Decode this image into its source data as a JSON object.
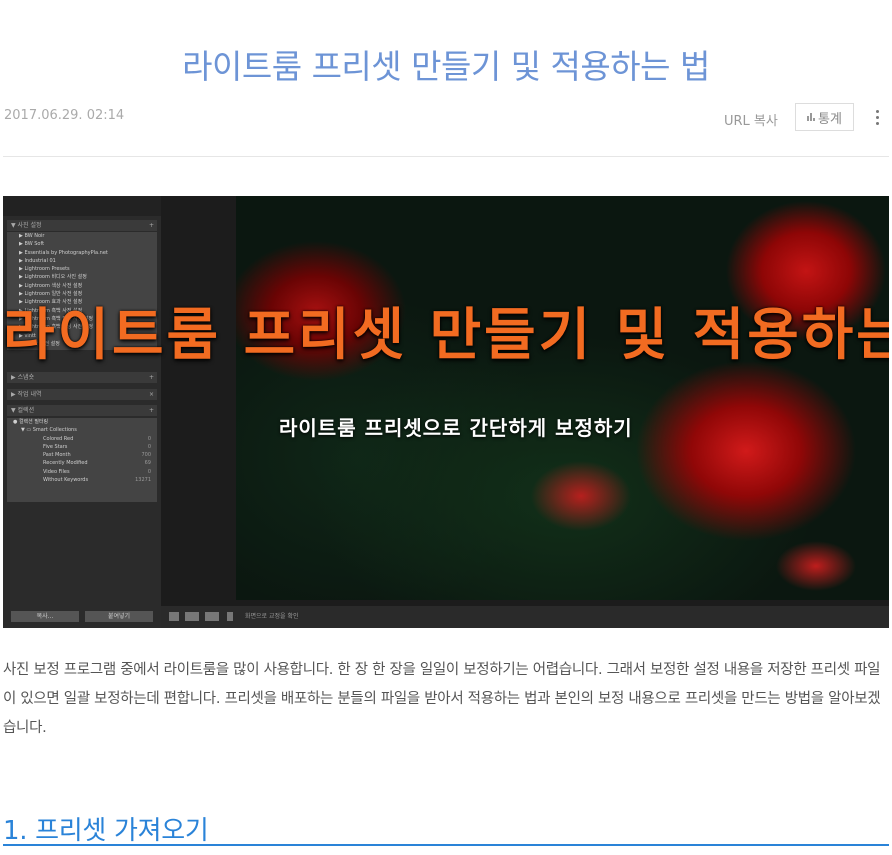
{
  "post": {
    "title": "라이트룸 프리셋 만들기 및 적용하는 법",
    "date": "2017.06.29. 02:14",
    "url_copy": "URL 복사",
    "stats": "통계"
  },
  "hero": {
    "overlay_title": "라이트룸 프리셋 만들기 및 적용하는 법",
    "overlay_subtitle": "라이트룸 프리셋으로 간단하게 보정하기",
    "lightroom": {
      "presets_header": "사진 설정",
      "presets": [
        "BW Noir",
        "BW Soft",
        "Essentials by PhotographyPla.net",
        "Industrial 01",
        "Lightroom Presets",
        "Lightroom 비디오 사진 설정",
        "Lightroom 색상 사전 설정",
        "Lightroom 일반 사전 설정",
        "Lightroom 효과 사전 설정",
        "Lightroom 흑백 사전 설정",
        "Lightroom 흑백 필터 사전 설정",
        "Lightroom 흑백 토닝 사전 설정",
        "vintt",
        "사용자 사전 설정"
      ],
      "snapshot_header": "스냅숏",
      "history_header": "작업 내역",
      "collections_header": "컬렉션",
      "collection_filter": "컬렉션 필터링",
      "smart_collections": "Smart Collections",
      "smart_items": [
        {
          "name": "Colored Red",
          "count": "0"
        },
        {
          "name": "Five Stars",
          "count": "0"
        },
        {
          "name": "Past Month",
          "count": "700"
        },
        {
          "name": "Recently Modified",
          "count": "69"
        },
        {
          "name": "Video Files",
          "count": "0"
        },
        {
          "name": "Without Keywords",
          "count": "13271"
        }
      ],
      "copy_btn": "복사...",
      "paste_btn": "붙여넣기",
      "toolbar_text": "화면으로 교정을 확인"
    }
  },
  "body": {
    "intro": "사진 보정 프로그램 중에서 라이트룸을 많이 사용합니다. 한 장 한 장을 일일이 보정하기는 어렵습니다. 그래서 보정한 설정 내용을 저장한 프리셋 파일이 있으면 일괄 보정하는데 편합니다. 프리셋을 배포하는 분들의 파일을 받아서 적용하는 법과 본인의 보정 내용으로 프리셋을 만드는 방법을 알아보겠습니다.",
    "section1": "1. 프리셋 가져오기"
  },
  "colors": {
    "title": "#6d94d6",
    "heading": "#2a83d8",
    "overlay_title": "#f26b21"
  },
  "icons": {
    "stats": "bar-chart-icon",
    "more": "vertical-ellipsis-icon"
  }
}
